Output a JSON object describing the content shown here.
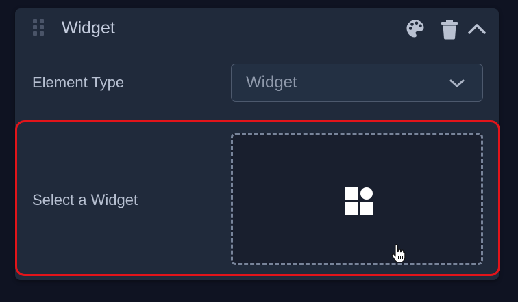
{
  "panel": {
    "title": "Widget",
    "icons": {
      "drag": "drag-handle-icon",
      "palette": "palette-icon",
      "trash": "trash-icon",
      "collapse": "chevron-up-icon"
    }
  },
  "element_type": {
    "label": "Element Type",
    "selected": "Widget"
  },
  "widget_select": {
    "label": "Select a Widget",
    "icon": "widgets-icon"
  },
  "colors": {
    "highlight": "#e2141a",
    "panel_bg": "#202a3b",
    "page_bg": "#0f1322"
  }
}
